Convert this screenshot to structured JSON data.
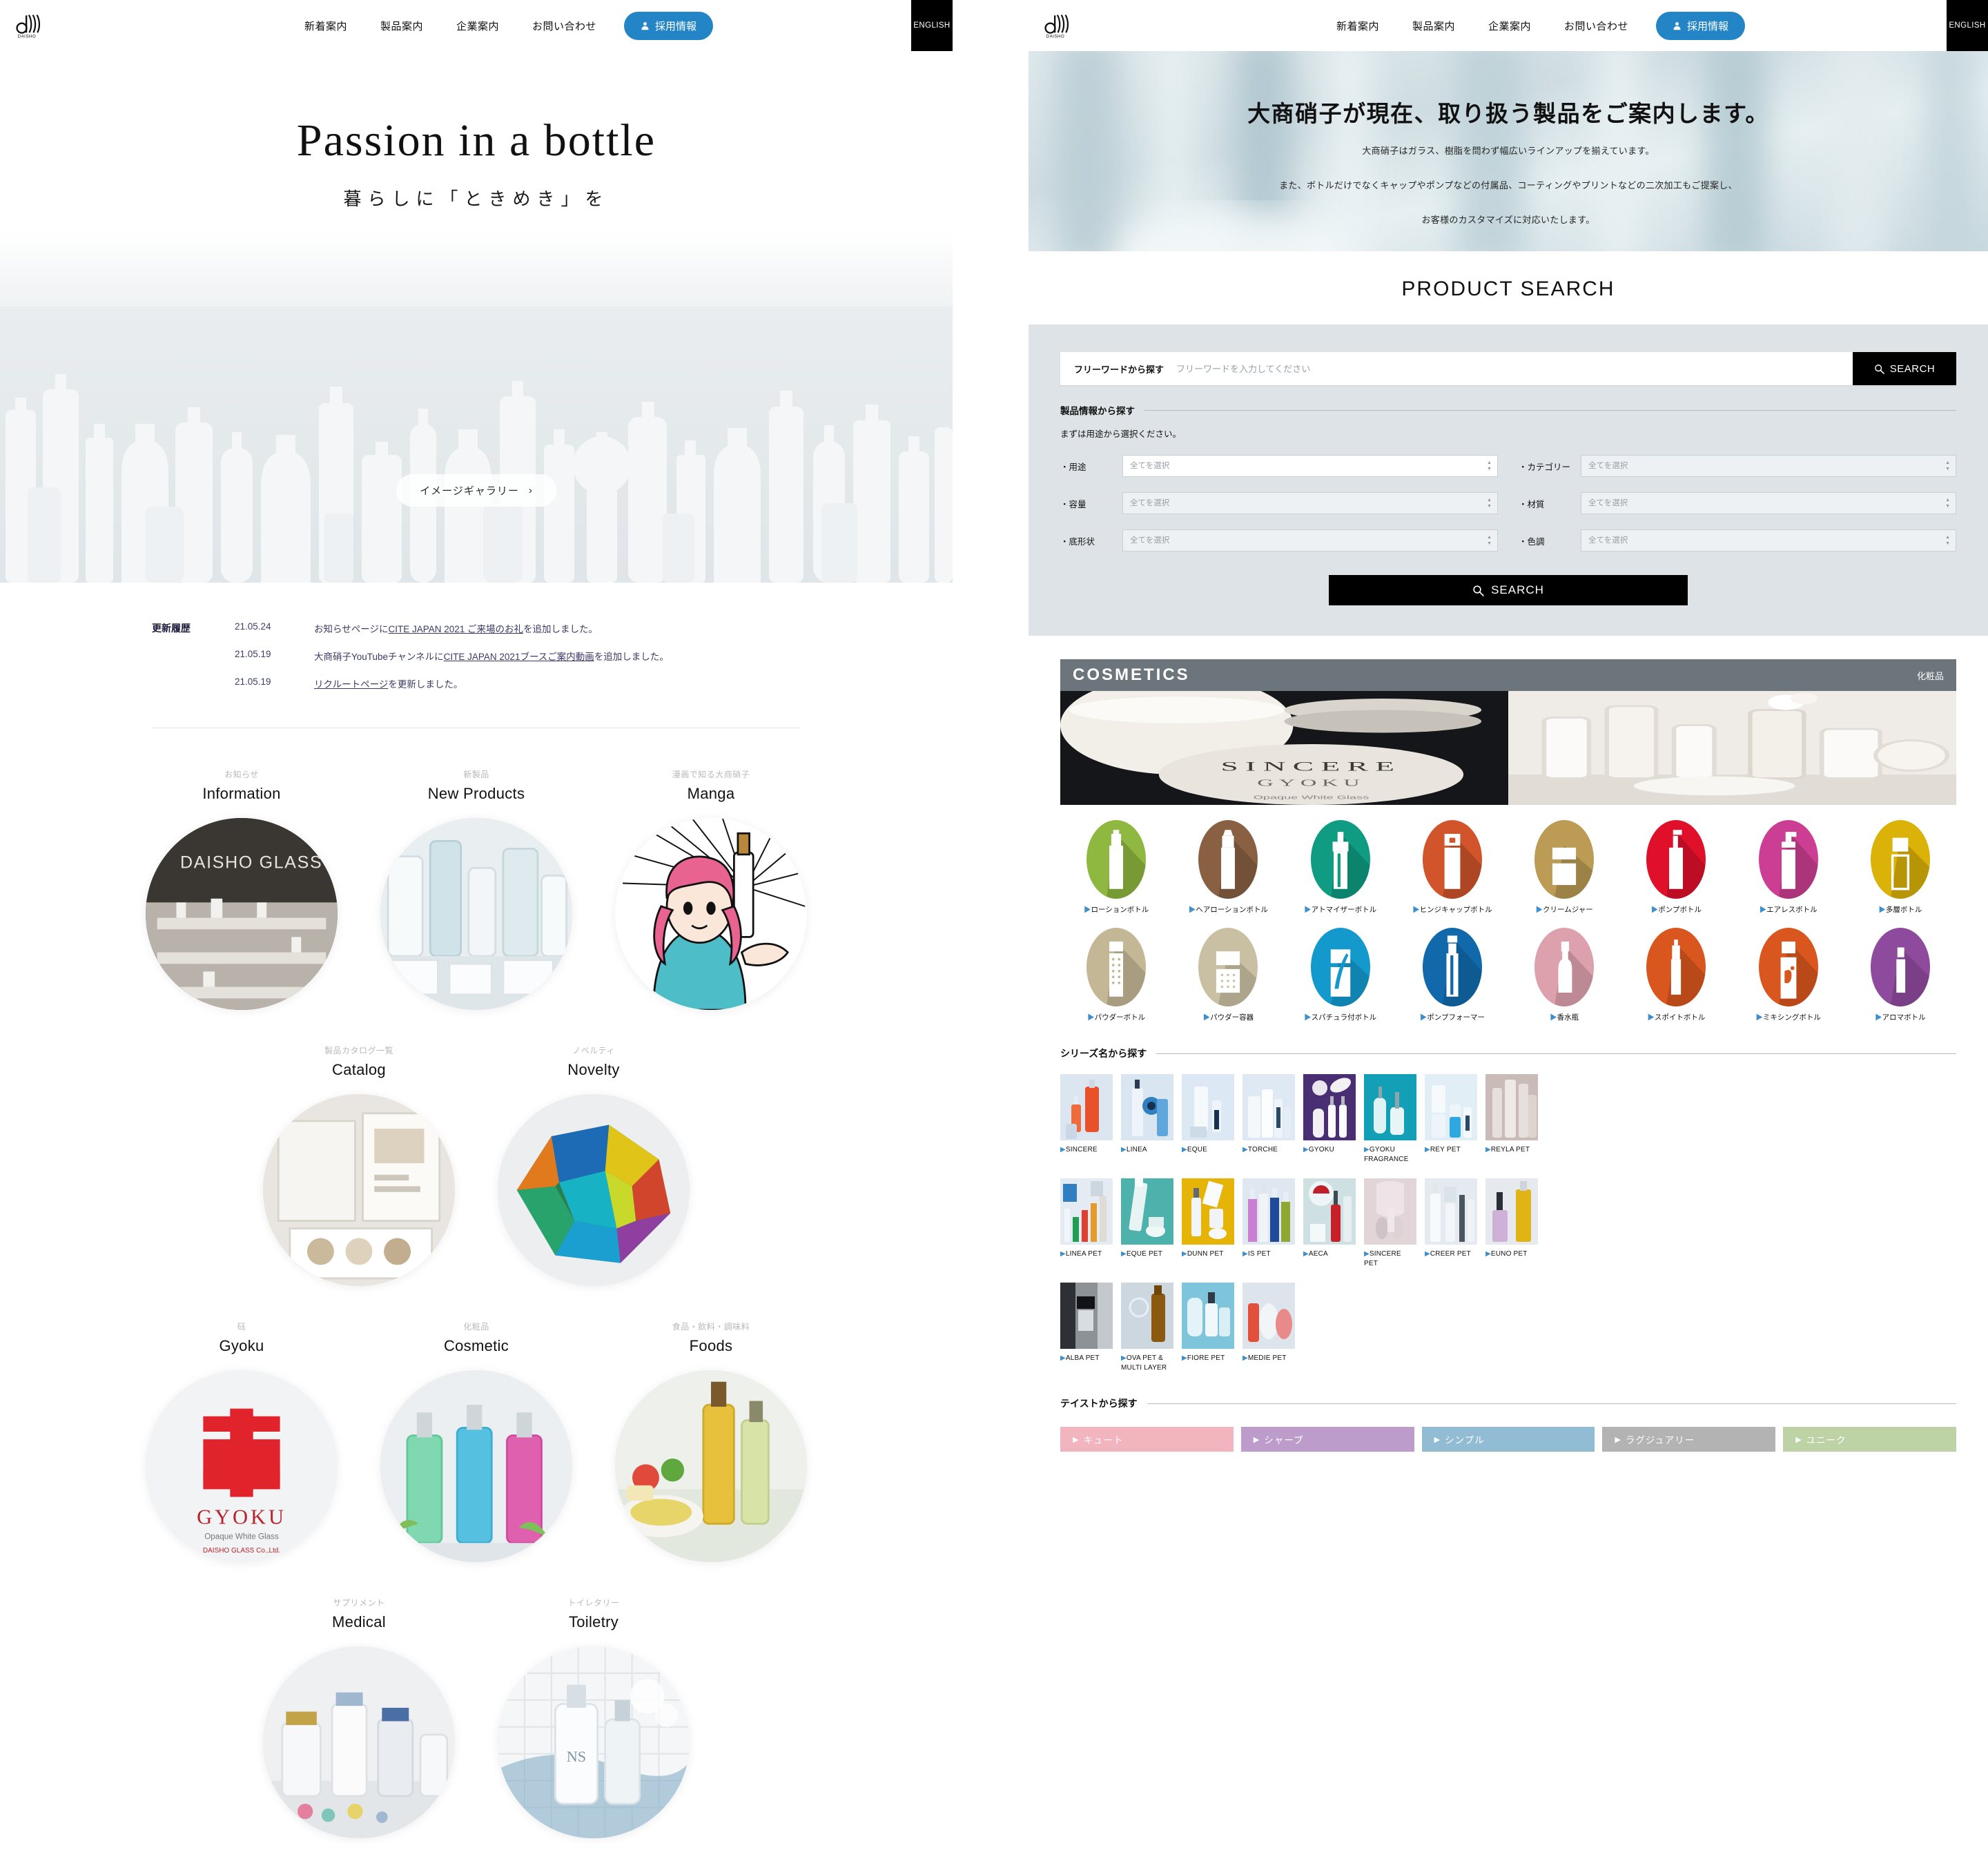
{
  "header": {
    "logo_text": "DAISHO",
    "nav": [
      {
        "label": "新着案内"
      },
      {
        "label": "製品案内"
      },
      {
        "label": "企業案内"
      },
      {
        "label": "お問い合わせ"
      }
    ],
    "recruit_label": "採用情報",
    "english_label": "ENGLISH",
    "accent_color": "#2385c6"
  },
  "left": {
    "hero": {
      "title": "Passion in a bottle",
      "subtitle": "暮らしに「ときめき」を",
      "gallery_button": "イメージギャラリー",
      "gallery_chevron": "›"
    },
    "news": {
      "label": "更新履歴",
      "items": [
        {
          "date": "21.05.24",
          "pre": "お知らせページに",
          "link": "CITE JAPAN 2021 ご来場のお礼",
          "post": "を追加しました。"
        },
        {
          "date": "21.05.19",
          "pre": "大商硝子YouTubeチャンネルに",
          "link": "CITE JAPAN 2021ブースご案内動画",
          "post": "を追加しました。"
        },
        {
          "date": "21.05.19",
          "pre": "",
          "link": "リクルートページ",
          "post": "を更新しました。"
        }
      ]
    },
    "categories_row1": [
      {
        "jp": "お知らせ",
        "en": "Information",
        "image": "showroom-photo"
      },
      {
        "jp": "新製品",
        "en": "New Products",
        "image": "new-products-photo"
      },
      {
        "jp": "漫画で知る大商硝子",
        "en": "Manga",
        "image": "manga-illustration"
      }
    ],
    "categories_row2": [
      {
        "jp": "製品カタログ一覧",
        "en": "Catalog",
        "image": "catalog-photo"
      },
      {
        "jp": "ノベルティ",
        "en": "Novelty",
        "image": "novelty-crystal-photo"
      }
    ],
    "categories_row3": [
      {
        "jp": "砡",
        "en": "Gyoku",
        "image": "gyoku-logo"
      },
      {
        "jp": "化粧品",
        "en": "Cosmetic",
        "image": "cosmetic-bottles-photo"
      },
      {
        "jp": "食品・飲料・調味料",
        "en": "Foods",
        "image": "foods-photo"
      }
    ],
    "categories_row4": [
      {
        "jp": "サプリメント",
        "en": "Medical",
        "image": "medical-photo"
      },
      {
        "jp": "トイレタリー",
        "en": "Toiletry",
        "image": "toiletry-photo"
      }
    ]
  },
  "right": {
    "hero": {
      "headline": "大商硝子が現在、取り扱う製品をご案内します。",
      "lines": [
        "大商硝子はガラス、樹脂を問わず幅広いラインアップを揃えています。",
        "また、ボトルだけでなくキャップやポンプなどの付属品、コーティングやプリントなどの二次加工もご提案し、",
        "お客様のカスタマイズに対応いたします。"
      ]
    },
    "product_search": {
      "title": "PRODUCT SEARCH",
      "freeword_label": "フリーワードから探す",
      "freeword_placeholder": "フリーワードを入力してください",
      "freeword_value": "",
      "search_small_label": "SEARCH",
      "info_label": "製品情報から探す",
      "hint": "まずは用途から選択ください。",
      "selects": [
        {
          "label": "・用途",
          "value": "全てを選択",
          "active": true
        },
        {
          "label": "・カテゴリー",
          "value": "全てを選択",
          "active": false
        },
        {
          "label": "・容量",
          "value": "全てを選択",
          "active": false
        },
        {
          "label": "・材質",
          "value": "全てを選択",
          "active": false
        },
        {
          "label": "・底形状",
          "value": "全てを選択",
          "active": false
        },
        {
          "label": "・色調",
          "value": "全てを選択",
          "active": false
        }
      ],
      "search_big_label": "SEARCH"
    },
    "cosmetics": {
      "banner_en": "COSMETICS",
      "banner_jp": "化粧品",
      "icons_row1": [
        {
          "label": "ローションボトル",
          "color": "#8fb840",
          "icon": "lotion-bottle"
        },
        {
          "label": "ヘアローションボトル",
          "color": "#8a6043",
          "icon": "hair-lotion-bottle"
        },
        {
          "label": "アトマイザーボトル",
          "color": "#0f9c82",
          "icon": "atomizer-bottle"
        },
        {
          "label": "ヒンジキャップボトル",
          "color": "#d1542a",
          "icon": "hinge-cap-bottle"
        },
        {
          "label": "クリームジャー",
          "color": "#bc9b55",
          "icon": "cream-jar"
        },
        {
          "label": "ポンプボトル",
          "color": "#e0102b",
          "icon": "pump-bottle"
        },
        {
          "label": "エアレスボトル",
          "color": "#cc3e93",
          "icon": "airless-bottle"
        },
        {
          "label": "多層ボトル",
          "color": "#dab208",
          "icon": "multilayer-bottle"
        }
      ],
      "icons_row2": [
        {
          "label": "パウダーボトル",
          "color": "#c4b795",
          "icon": "powder-bottle"
        },
        {
          "label": "パウダー容器",
          "color": "#c9c0a4",
          "icon": "powder-container"
        },
        {
          "label": "スパチュラ付ボトル",
          "color": "#1499cd",
          "icon": "spatula-bottle"
        },
        {
          "label": "ポンプフォーマー",
          "color": "#1169ab",
          "icon": "pump-former"
        },
        {
          "label": "香水瓶",
          "color": "#dda0ad",
          "icon": "perfume-bottle"
        },
        {
          "label": "スポイトボトル",
          "color": "#d9561f",
          "icon": "dropper-bottle"
        },
        {
          "label": "ミキシングボトル",
          "color": "#d9561f",
          "icon": "mixing-bottle"
        },
        {
          "label": "アロマボトル",
          "color": "#8e4a9c",
          "icon": "aroma-bottle"
        }
      ],
      "series_label": "シリーズ名から探す",
      "series_row1": [
        {
          "label": "SINCERE",
          "img": "sincere-thumb"
        },
        {
          "label": "LINEA",
          "img": "linea-thumb"
        },
        {
          "label": "EQUE",
          "img": "eque-thumb"
        },
        {
          "label": "TORCHE",
          "img": "torche-thumb"
        },
        {
          "label": "GYOKU",
          "img": "gyoku-thumb"
        },
        {
          "label": "GYOKU FRAGRANCE",
          "img": "gyoku-fragrance-thumb"
        },
        {
          "label": "REY PET",
          "img": "rey-pet-thumb"
        },
        {
          "label": "REYLA PET",
          "img": "reyla-pet-thumb"
        }
      ],
      "series_row2": [
        {
          "label": "LINEA PET",
          "img": "linea-pet-thumb"
        },
        {
          "label": "EQUE PET",
          "img": "eque-pet-thumb"
        },
        {
          "label": "DUNN PET",
          "img": "dunn-pet-thumb"
        },
        {
          "label": "IS PET",
          "img": "is-pet-thumb"
        },
        {
          "label": "AECA",
          "img": "aeca-thumb"
        },
        {
          "label": "SINCERE PET",
          "img": "sincere-pet-thumb"
        },
        {
          "label": "CREER PET",
          "img": "creer-pet-thumb"
        },
        {
          "label": "EUNO PET",
          "img": "euno-pet-thumb"
        }
      ],
      "series_row3": [
        {
          "label": "ALBA PET",
          "img": "alba-pet-thumb"
        },
        {
          "label": "OVA PET & MULTI LAYER",
          "img": "ova-pet-thumb"
        },
        {
          "label": "FIORE PET",
          "img": "fiore-pet-thumb"
        },
        {
          "label": "MEDIE PET",
          "img": "medie-pet-thumb"
        }
      ],
      "taste_label": "テイストから探す",
      "tastes": [
        {
          "label": "キュート",
          "color": "#f2b5c0"
        },
        {
          "label": "シャープ",
          "color": "#bd9ccb"
        },
        {
          "label": "シンプル",
          "color": "#91bcd4"
        },
        {
          "label": "ラグジュアリー",
          "color": "#b3b3b3"
        },
        {
          "label": "ユニーク",
          "color": "#bdd3a6"
        }
      ]
    }
  }
}
